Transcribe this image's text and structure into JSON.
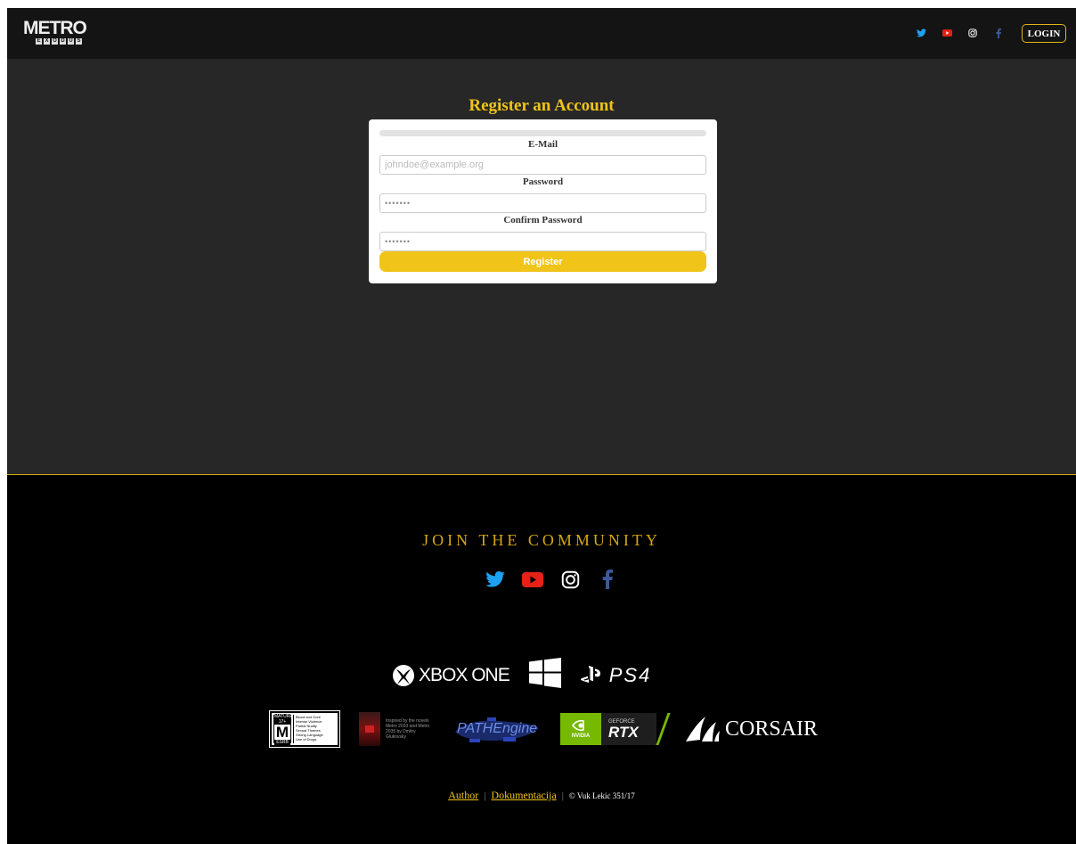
{
  "header": {
    "logo": {
      "main": "METRO",
      "sub": [
        "E",
        "X",
        "O",
        "D",
        "U",
        "S"
      ]
    },
    "social_icons": [
      "twitter-icon",
      "youtube-icon",
      "instagram-icon",
      "facebook-icon"
    ],
    "login_label": "LOGIN"
  },
  "colors": {
    "accent": "#f0c419",
    "twitter": "#1da1f2",
    "youtube": "#e62117",
    "instagram": "#ffffff",
    "facebook": "#3b5998"
  },
  "register": {
    "title": "Register an Account",
    "progress": 0,
    "email": {
      "label": "E-Mail",
      "placeholder": "johndoe@example.org"
    },
    "password": {
      "label": "Password",
      "value": "•••••••"
    },
    "confirm": {
      "label": "Confirm Password",
      "value": "•••••••"
    },
    "submit_label": "Register"
  },
  "footer": {
    "join_label": "JOIN THE COMMUNITY",
    "platforms": {
      "xbox": "XBOX ONE",
      "ps4": "PS4"
    },
    "esrb": {
      "rating": "M",
      "header": "MATURE 17+",
      "footer": "ESRB",
      "descriptors": [
        "Blood and Gore",
        "Intense Violence",
        "Partial Nudity",
        "Sexual Themes",
        "Strong Language",
        "Use of Drugs"
      ]
    },
    "book_text": "Inspired by the novels Metro 2033 and Metro 2035 by Dmitry Glukovsky",
    "pathengine": "PATHEngine",
    "nvidia": {
      "brand": "NVIDIA",
      "sub": "GEFORCE",
      "main": "RTX"
    },
    "corsair": "CORSAIR",
    "credits": {
      "author": "Author",
      "docs": "Dokumentacija",
      "copyright": "© Vuk Lekic 351/17"
    }
  }
}
